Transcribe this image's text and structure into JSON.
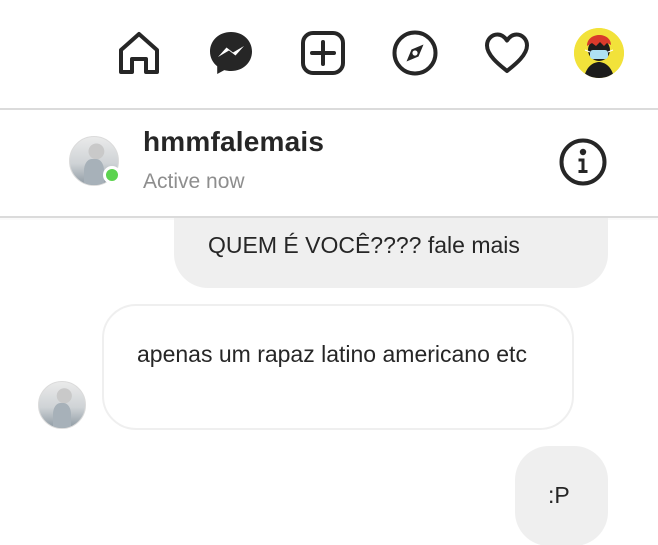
{
  "nav": {
    "items": [
      {
        "id": "home",
        "icon": "home-icon"
      },
      {
        "id": "direct",
        "icon": "messenger-icon"
      },
      {
        "id": "new_post",
        "icon": "plus-square-icon"
      },
      {
        "id": "explore",
        "icon": "compass-icon"
      },
      {
        "id": "activity",
        "icon": "heart-icon"
      },
      {
        "id": "profile",
        "icon": "profile-avatar"
      }
    ]
  },
  "thread": {
    "username": "hmmfalemais",
    "status": "Active now",
    "online_color": "#5cd34f"
  },
  "messages": [
    {
      "direction": "sent",
      "text": "QUEM É VOCÊ???? fale mais"
    },
    {
      "direction": "received",
      "text": "apenas um rapaz latino americano etc"
    },
    {
      "direction": "sent",
      "text": ":P"
    }
  ],
  "colors": {
    "sent_bubble": "#efefef",
    "border": "#dbdbdb",
    "muted_text": "#8e8e8e"
  }
}
